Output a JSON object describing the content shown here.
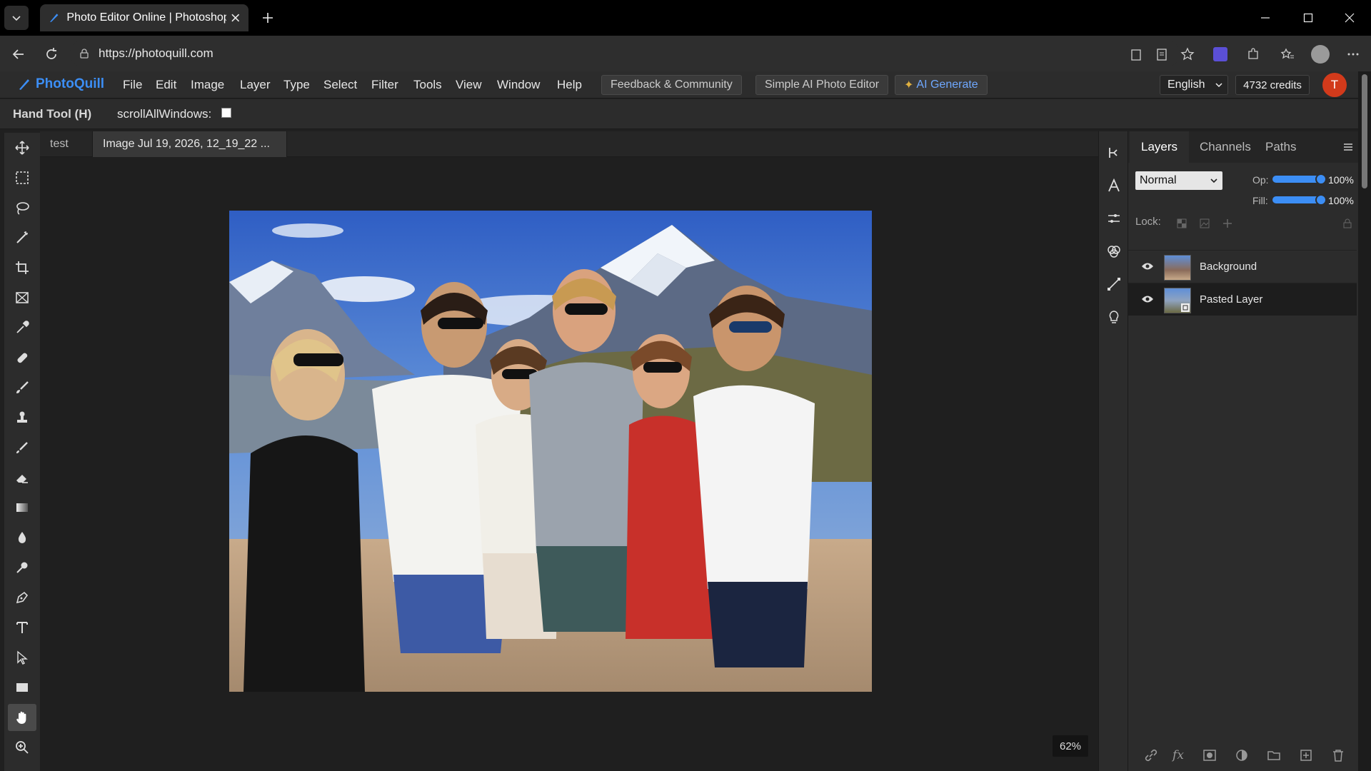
{
  "browser": {
    "tab_title": "Photo Editor Online | Photoshop A",
    "url": "https://photoquill.com"
  },
  "app": {
    "logo": "PhotoQuill",
    "menus": [
      "File",
      "Edit",
      "Image",
      "Layer",
      "Type",
      "Select",
      "Filter",
      "Tools",
      "View",
      "Window",
      "Help"
    ],
    "feedback_label": "Feedback & Community",
    "simple_ai_label": "Simple AI Photo Editor",
    "ai_generate_label": "AI Generate",
    "language": "English",
    "credits": "4732 credits",
    "avatar_letter": "T"
  },
  "options_bar": {
    "tool_name": "Hand Tool (H)",
    "scroll_all_windows_label": "scrollAllWindows:",
    "scroll_all_windows_checked": false
  },
  "documents": {
    "tabs": [
      "test",
      "Image Jul 19, 2026, 12_19_22 ..."
    ],
    "active_index": 1,
    "zoom": "62%"
  },
  "layers_panel": {
    "tabs": [
      "Layers",
      "Channels",
      "Paths"
    ],
    "blend_mode": "Normal",
    "opacity_label": "Op:",
    "opacity_value": "100%",
    "fill_label": "Fill:",
    "fill_value": "100%",
    "lock_label": "Lock:",
    "layers": [
      {
        "name": "Background",
        "visible": true,
        "selected": false
      },
      {
        "name": "Pasted Layer",
        "visible": true,
        "selected": true
      }
    ]
  },
  "colors": {
    "accent": "#3c8ef5",
    "avatar_bg": "#d23a1b",
    "panel_bg": "#2c2c2c",
    "canvas_bg": "#1f1f1f"
  }
}
